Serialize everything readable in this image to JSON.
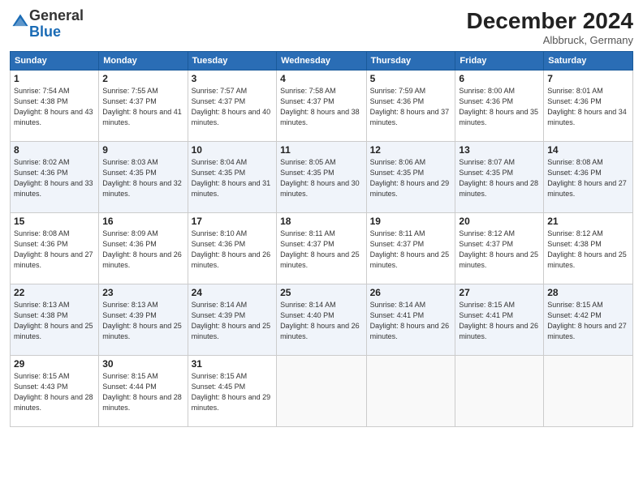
{
  "logo": {
    "general": "General",
    "blue": "Blue"
  },
  "header": {
    "month": "December 2024",
    "location": "Albbruck, Germany"
  },
  "weekdays": [
    "Sunday",
    "Monday",
    "Tuesday",
    "Wednesday",
    "Thursday",
    "Friday",
    "Saturday"
  ],
  "weeks": [
    [
      {
        "day": "1",
        "sunrise": "7:54 AM",
        "sunset": "4:38 PM",
        "daylight": "8 hours and 43 minutes."
      },
      {
        "day": "2",
        "sunrise": "7:55 AM",
        "sunset": "4:37 PM",
        "daylight": "8 hours and 41 minutes."
      },
      {
        "day": "3",
        "sunrise": "7:57 AM",
        "sunset": "4:37 PM",
        "daylight": "8 hours and 40 minutes."
      },
      {
        "day": "4",
        "sunrise": "7:58 AM",
        "sunset": "4:37 PM",
        "daylight": "8 hours and 38 minutes."
      },
      {
        "day": "5",
        "sunrise": "7:59 AM",
        "sunset": "4:36 PM",
        "daylight": "8 hours and 37 minutes."
      },
      {
        "day": "6",
        "sunrise": "8:00 AM",
        "sunset": "4:36 PM",
        "daylight": "8 hours and 35 minutes."
      },
      {
        "day": "7",
        "sunrise": "8:01 AM",
        "sunset": "4:36 PM",
        "daylight": "8 hours and 34 minutes."
      }
    ],
    [
      {
        "day": "8",
        "sunrise": "8:02 AM",
        "sunset": "4:36 PM",
        "daylight": "8 hours and 33 minutes."
      },
      {
        "day": "9",
        "sunrise": "8:03 AM",
        "sunset": "4:35 PM",
        "daylight": "8 hours and 32 minutes."
      },
      {
        "day": "10",
        "sunrise": "8:04 AM",
        "sunset": "4:35 PM",
        "daylight": "8 hours and 31 minutes."
      },
      {
        "day": "11",
        "sunrise": "8:05 AM",
        "sunset": "4:35 PM",
        "daylight": "8 hours and 30 minutes."
      },
      {
        "day": "12",
        "sunrise": "8:06 AM",
        "sunset": "4:35 PM",
        "daylight": "8 hours and 29 minutes."
      },
      {
        "day": "13",
        "sunrise": "8:07 AM",
        "sunset": "4:35 PM",
        "daylight": "8 hours and 28 minutes."
      },
      {
        "day": "14",
        "sunrise": "8:08 AM",
        "sunset": "4:36 PM",
        "daylight": "8 hours and 27 minutes."
      }
    ],
    [
      {
        "day": "15",
        "sunrise": "8:08 AM",
        "sunset": "4:36 PM",
        "daylight": "8 hours and 27 minutes."
      },
      {
        "day": "16",
        "sunrise": "8:09 AM",
        "sunset": "4:36 PM",
        "daylight": "8 hours and 26 minutes."
      },
      {
        "day": "17",
        "sunrise": "8:10 AM",
        "sunset": "4:36 PM",
        "daylight": "8 hours and 26 minutes."
      },
      {
        "day": "18",
        "sunrise": "8:11 AM",
        "sunset": "4:37 PM",
        "daylight": "8 hours and 25 minutes."
      },
      {
        "day": "19",
        "sunrise": "8:11 AM",
        "sunset": "4:37 PM",
        "daylight": "8 hours and 25 minutes."
      },
      {
        "day": "20",
        "sunrise": "8:12 AM",
        "sunset": "4:37 PM",
        "daylight": "8 hours and 25 minutes."
      },
      {
        "day": "21",
        "sunrise": "8:12 AM",
        "sunset": "4:38 PM",
        "daylight": "8 hours and 25 minutes."
      }
    ],
    [
      {
        "day": "22",
        "sunrise": "8:13 AM",
        "sunset": "4:38 PM",
        "daylight": "8 hours and 25 minutes."
      },
      {
        "day": "23",
        "sunrise": "8:13 AM",
        "sunset": "4:39 PM",
        "daylight": "8 hours and 25 minutes."
      },
      {
        "day": "24",
        "sunrise": "8:14 AM",
        "sunset": "4:39 PM",
        "daylight": "8 hours and 25 minutes."
      },
      {
        "day": "25",
        "sunrise": "8:14 AM",
        "sunset": "4:40 PM",
        "daylight": "8 hours and 26 minutes."
      },
      {
        "day": "26",
        "sunrise": "8:14 AM",
        "sunset": "4:41 PM",
        "daylight": "8 hours and 26 minutes."
      },
      {
        "day": "27",
        "sunrise": "8:15 AM",
        "sunset": "4:41 PM",
        "daylight": "8 hours and 26 minutes."
      },
      {
        "day": "28",
        "sunrise": "8:15 AM",
        "sunset": "4:42 PM",
        "daylight": "8 hours and 27 minutes."
      }
    ],
    [
      {
        "day": "29",
        "sunrise": "8:15 AM",
        "sunset": "4:43 PM",
        "daylight": "8 hours and 28 minutes."
      },
      {
        "day": "30",
        "sunrise": "8:15 AM",
        "sunset": "4:44 PM",
        "daylight": "8 hours and 28 minutes."
      },
      {
        "day": "31",
        "sunrise": "8:15 AM",
        "sunset": "4:45 PM",
        "daylight": "8 hours and 29 minutes."
      },
      null,
      null,
      null,
      null
    ]
  ],
  "labels": {
    "sunrise": "Sunrise:",
    "sunset": "Sunset:",
    "daylight": "Daylight:"
  }
}
